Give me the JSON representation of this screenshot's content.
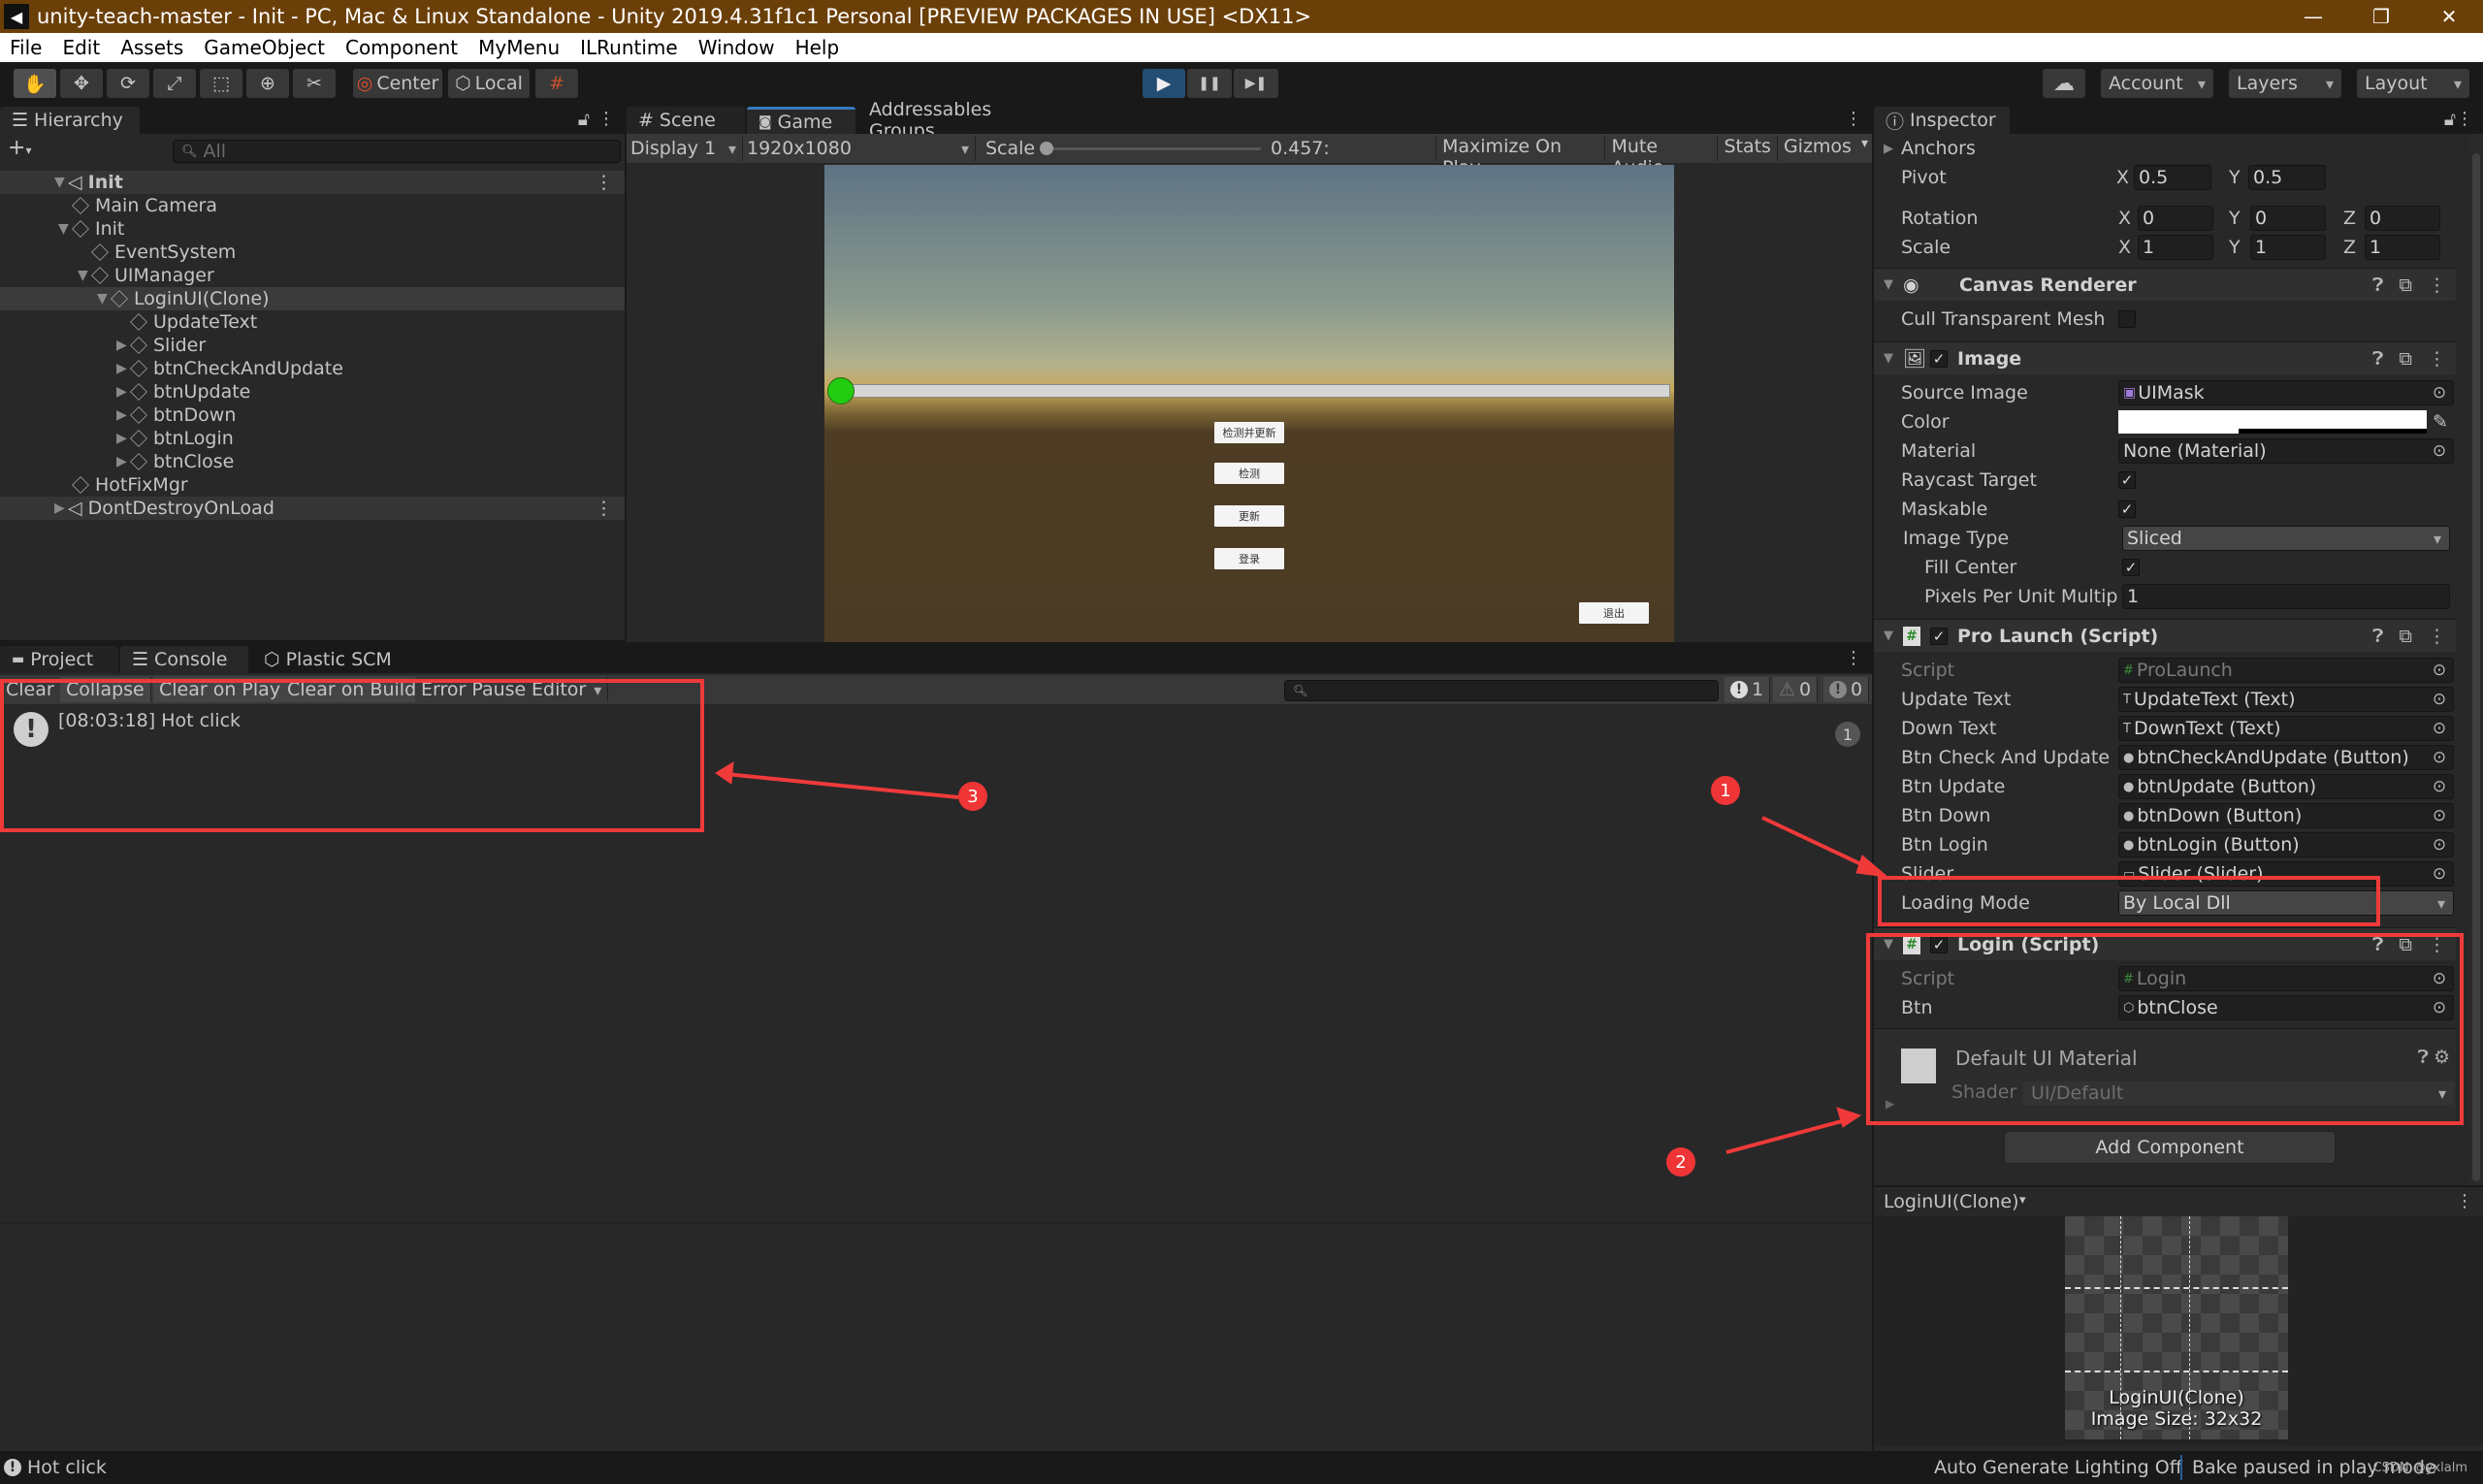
{
  "window": {
    "title": "unity-teach-master - Init - PC, Mac & Linux Standalone - Unity 2019.4.31f1c1 Personal [PREVIEW PACKAGES IN USE] <DX11>",
    "controls": {
      "minimize": "—",
      "restore": "❐",
      "close": "✕"
    }
  },
  "menu": [
    "File",
    "Edit",
    "Assets",
    "GameObject",
    "Component",
    "MyMenu",
    "ILRuntime",
    "Window",
    "Help"
  ],
  "toolbar": {
    "tools": [
      {
        "name": "hand-tool",
        "glyph": "✋"
      },
      {
        "name": "move-tool",
        "glyph": "✥"
      },
      {
        "name": "rotate-tool",
        "glyph": "⟳"
      },
      {
        "name": "scale-tool",
        "glyph": "⤢"
      },
      {
        "name": "rect-tool",
        "glyph": "⬚"
      },
      {
        "name": "transform-tool",
        "glyph": "⊕"
      },
      {
        "name": "custom-tool",
        "glyph": "✂"
      }
    ],
    "pivot_mode": "Center",
    "pivot_rotation": "Local",
    "snap_glyph": "#",
    "play": "▶",
    "pause": "❚❚",
    "step": "▶❚",
    "cloud_glyph": "☁",
    "account": "Account",
    "layers": "Layers",
    "layout": "Layout"
  },
  "hierarchy": {
    "tab": "Hierarchy",
    "add_glyph": "+",
    "search_placeholder": "All",
    "items": [
      {
        "label": "Init",
        "depth": 0,
        "type": "scene",
        "expanded": "▼"
      },
      {
        "label": "Main Camera",
        "depth": 1,
        "type": "object",
        "expanded": ""
      },
      {
        "label": "Init",
        "depth": 1,
        "type": "object",
        "expanded": "▼"
      },
      {
        "label": "EventSystem",
        "depth": 2,
        "type": "object",
        "expanded": ""
      },
      {
        "label": "UIManager",
        "depth": 2,
        "type": "object",
        "expanded": "▼"
      },
      {
        "label": "LoginUI(Clone)",
        "depth": 3,
        "type": "object",
        "expanded": "▼",
        "selected": true
      },
      {
        "label": "UpdateText",
        "depth": 4,
        "type": "object",
        "expanded": ""
      },
      {
        "label": "Slider",
        "depth": 4,
        "type": "object",
        "expanded": "▶"
      },
      {
        "label": "btnCheckAndUpdate",
        "depth": 4,
        "type": "object",
        "expanded": "▶"
      },
      {
        "label": "btnUpdate",
        "depth": 4,
        "type": "object",
        "expanded": "▶"
      },
      {
        "label": "btnDown",
        "depth": 4,
        "type": "object",
        "expanded": "▶"
      },
      {
        "label": "btnLogin",
        "depth": 4,
        "type": "object",
        "expanded": "▶"
      },
      {
        "label": "btnClose",
        "depth": 4,
        "type": "object",
        "expanded": "▶"
      },
      {
        "label": "HotFixMgr",
        "depth": 1,
        "type": "object",
        "expanded": ""
      },
      {
        "label": "DontDestroyOnLoad",
        "depth": 0,
        "type": "scene",
        "expanded": "▶"
      }
    ]
  },
  "game_panel": {
    "tabs": [
      {
        "label": "Scene",
        "glyph": "#"
      },
      {
        "label": "Game",
        "glyph": "🎮"
      },
      {
        "label": "Addressables Groups",
        "glyph": ""
      }
    ],
    "display": "Display 1",
    "resolution": "1920x1080",
    "scale_label": "Scale",
    "scale_value": "0.457:",
    "scale_slider_fraction": 0.0,
    "toggles": [
      "Maximize On Play",
      "Mute Audio",
      "Stats",
      "Gizmos"
    ],
    "game_ui": {
      "slider_progress": 0.0,
      "buttons": [
        "检测并更新",
        "检测",
        "更新",
        "登录"
      ],
      "exit_button": "退出"
    }
  },
  "console": {
    "tabs": [
      {
        "label": "Project",
        "glyph": "▬"
      },
      {
        "label": "Console",
        "glyph": "☰"
      },
      {
        "label": "Plastic SCM",
        "glyph": "⬡"
      }
    ],
    "buttons": [
      "Clear",
      "Collapse",
      "Clear on Play",
      "Clear on Build",
      "Error Pause",
      "Editor"
    ],
    "search_placeholder": "",
    "counts": {
      "log": "1",
      "warning": "0",
      "error": "0"
    },
    "entries": [
      {
        "text": "[08:03:18] Hot click",
        "count": "1"
      }
    ]
  },
  "inspector": {
    "tab": "Inspector",
    "anchors": "Anchors",
    "pivot": {
      "label": "Pivot",
      "x": "0.5",
      "y": "0.5"
    },
    "rotation": {
      "label": "Rotation",
      "x": "0",
      "y": "0",
      "z": "0"
    },
    "scale": {
      "label": "Scale",
      "x": "1",
      "y": "1",
      "z": "1"
    },
    "canvas_renderer": {
      "title": "Canvas Renderer",
      "cull_label": "Cull Transparent Mesh",
      "cull_checked": false
    },
    "image": {
      "title": "Image",
      "enabled": true,
      "fields": {
        "source_image": {
          "label": "Source Image",
          "value": "UIMask"
        },
        "color": {
          "label": "Color",
          "value": "#FFFFFF"
        },
        "material": {
          "label": "Material",
          "value": "None (Material)"
        },
        "raycast": {
          "label": "Raycast Target",
          "checked": true
        },
        "maskable": {
          "label": "Maskable",
          "checked": true
        },
        "image_type": {
          "label": "Image Type",
          "value": "Sliced"
        },
        "fill_center": {
          "label": "Fill Center",
          "checked": true
        },
        "ppu": {
          "label": "Pixels Per Unit Multiplie",
          "value": "1"
        }
      }
    },
    "pro_launch": {
      "title": "Pro Launch (Script)",
      "enabled": true,
      "fields": [
        {
          "label": "Script",
          "value": "ProLaunch",
          "icon": "#",
          "muted": true
        },
        {
          "label": "Update Text",
          "value": "UpdateText (Text)",
          "icon": "T"
        },
        {
          "label": "Down Text",
          "value": "DownText (Text)",
          "icon": "T"
        },
        {
          "label": "Btn Check And Update",
          "value": "btnCheckAndUpdate (Button)",
          "icon": "●"
        },
        {
          "label": "Btn Update",
          "value": "btnUpdate (Button)",
          "icon": "●"
        },
        {
          "label": "Btn Down",
          "value": "btnDown (Button)",
          "icon": "●"
        },
        {
          "label": "Btn Login",
          "value": "btnLogin (Button)",
          "icon": "●"
        },
        {
          "label": "Slider",
          "value": "Slider (Slider)",
          "icon": "▭"
        }
      ],
      "loading_mode": {
        "label": "Loading Mode",
        "value": "By Local Dll"
      }
    },
    "login": {
      "title": "Login (Script)",
      "enabled": true,
      "fields": [
        {
          "label": "Script",
          "value": "Login",
          "icon": "#",
          "muted": true
        },
        {
          "label": "Btn",
          "value": "btnClose",
          "icon": "⬡"
        }
      ]
    },
    "material": {
      "title": "Default UI Material",
      "shader_label": "Shader",
      "shader_value": "UI/Default"
    },
    "add_component": "Add Component",
    "preview": {
      "title": "LoginUI(Clone)",
      "caption_name": "LoginUI(Clone)",
      "caption_size": "Image Size: 32x32"
    }
  },
  "annotations": [
    {
      "number": "1"
    },
    {
      "number": "2"
    },
    {
      "number": "3"
    }
  ],
  "status_bar": {
    "message": "Hot click",
    "lighting": "Auto Generate Lighting Off",
    "bake": "Bake paused in play mode",
    "watermark": "CSDN @yxlalm"
  },
  "colors": {
    "title_bar": "#6B3F08",
    "play_active": "#244D73",
    "annotation_red": "#F03A3A",
    "slider_handle": "#22CC11"
  }
}
